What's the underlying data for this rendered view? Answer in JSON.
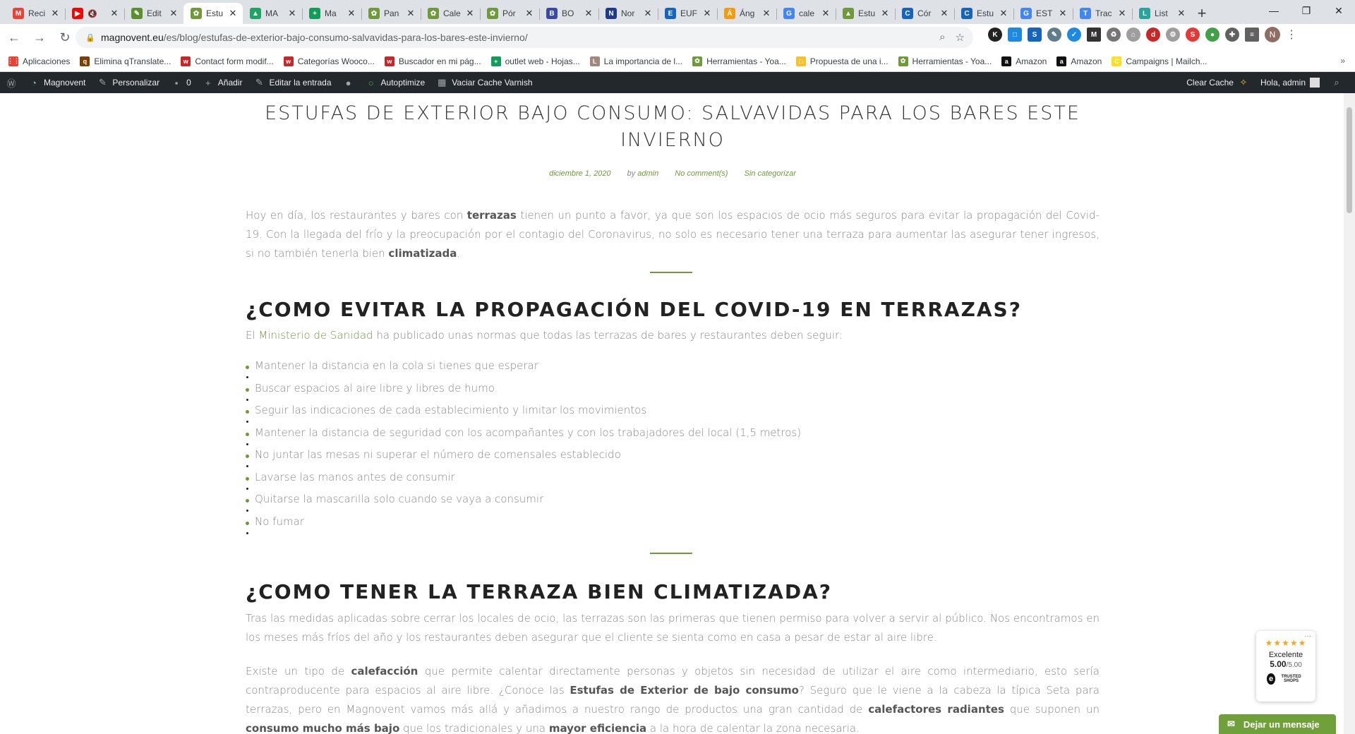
{
  "browser": {
    "tabs": [
      {
        "title": "Reci",
        "fav": "M",
        "color": "#ea4335",
        "active": false
      },
      {
        "title": "",
        "fav": "▶",
        "color": "#ff0000",
        "active": false,
        "muted": true
      },
      {
        "title": "Edit",
        "fav": "✎",
        "color": "#5a8f29",
        "active": false
      },
      {
        "title": "Estu",
        "fav": "✿",
        "color": "#6f9a3a",
        "active": true
      },
      {
        "title": "MA",
        "fav": "▲",
        "color": "#1fa463",
        "active": false
      },
      {
        "title": "Ma",
        "fav": "+",
        "color": "#0f9d58",
        "active": false
      },
      {
        "title": "Pan",
        "fav": "✿",
        "color": "#6f9a3a",
        "active": false
      },
      {
        "title": "Cale",
        "fav": "✿",
        "color": "#6f9a3a",
        "active": false
      },
      {
        "title": "Pór",
        "fav": "✿",
        "color": "#6f9a3a",
        "active": false
      },
      {
        "title": "BO",
        "fav": "B",
        "color": "#3949ab",
        "active": false
      },
      {
        "title": "Nor",
        "fav": "N",
        "color": "#1e3a8a",
        "active": false
      },
      {
        "title": "EUF",
        "fav": "E",
        "color": "#1565c0",
        "active": false
      },
      {
        "title": "Áng",
        "fav": "Á",
        "color": "#f39c12",
        "active": false
      },
      {
        "title": "cale",
        "fav": "G",
        "color": "#4285f4",
        "active": false
      },
      {
        "title": "Estu",
        "fav": "▲",
        "color": "#6f9a3a",
        "active": false
      },
      {
        "title": "Cór",
        "fav": "C",
        "color": "#1565c0",
        "active": false
      },
      {
        "title": "Estu",
        "fav": "C",
        "color": "#1565c0",
        "active": false
      },
      {
        "title": "EST",
        "fav": "G",
        "color": "#4285f4",
        "active": false
      },
      {
        "title": "Trac",
        "fav": "T",
        "color": "#4285f4",
        "active": false
      },
      {
        "title": "List",
        "fav": "L",
        "color": "#26a69a",
        "active": false
      }
    ],
    "newtab_label": "+",
    "url_host": "magnovent.eu",
    "url_path": "/es/blog/estufas-de-exterior-bajo-consumo-salvavidas-para-los-bares-este-invierno/",
    "avatar_letter": "N",
    "bookmarks": [
      {
        "label": "Aplicaciones",
        "icon": "⋮⋮",
        "color": "#ea4335"
      },
      {
        "label": "Elimina qTranslate...",
        "icon": "q",
        "color": "#7b3f00"
      },
      {
        "label": "Contact form modif...",
        "icon": "w",
        "color": "#c62828"
      },
      {
        "label": "Categorías Wooco...",
        "icon": "w",
        "color": "#c62828"
      },
      {
        "label": "Buscador en mi pág...",
        "icon": "w",
        "color": "#c62828"
      },
      {
        "label": "outlet web - Hojas...",
        "icon": "+",
        "color": "#0f9d58"
      },
      {
        "label": "La importancia de l...",
        "icon": "L",
        "color": "#a1887f"
      },
      {
        "label": "Herramientas - Yoa...",
        "icon": "✿",
        "color": "#6f9a3a"
      },
      {
        "label": "Propuesta de una i...",
        "icon": "□",
        "color": "#fbc02d"
      },
      {
        "label": "Herramientas - Yoa...",
        "icon": "✿",
        "color": "#6f9a3a"
      },
      {
        "label": "Amazon",
        "icon": "a",
        "color": "#111111"
      },
      {
        "label": "Amazon",
        "icon": "a",
        "color": "#111111"
      },
      {
        "label": "Campaigns | Mailch...",
        "icon": "C",
        "color": "#ffe01b"
      }
    ]
  },
  "wpbar": {
    "site": "Magnovent",
    "customize": "Personalizar",
    "comments": "0",
    "add": "Añadir",
    "edit": "Editar la entrada",
    "autoptimize": "Autoptimize",
    "varnish": "Vaciar Cache Varnish",
    "clear_cache": "Clear Cache",
    "greeting": "Hola, admin"
  },
  "post": {
    "title_line1": "ESTUFAS DE EXTERIOR BAJO CONSUMO: SALVAVIDAS PARA LOS BARES ESTE",
    "title_line2": "INVIERNO",
    "date": "diciembre 1, 2020",
    "by": "by",
    "author": "admin",
    "comments": "No comment(s)",
    "category": "Sin categorizar",
    "intro_a": "Hoy en día, los restaurantes y bares con ",
    "intro_b": "terrazas",
    "intro_c": " tienen un punto a favor, ya que son los espacios de ocio más seguros para evitar la propagación del Covid-19. Con la llegada del frío y la preocupación por el contagio del Coronavirus, no solo es necesario tener una terraza para aumentar las asegurar tener ingresos, si no también tenerla bien ",
    "intro_d": "climatizada",
    "intro_e": ".",
    "h2_1": "¿COMO EVITAR LA PROPAGACIÓN DEL COVID-19 EN TERRAZAS?",
    "p2_a": "El ",
    "p2_link": "Ministerio de Sanidad",
    "p2_b": " ha publicado unas normas que todas las terrazas de bares y restaurantes deben seguir:",
    "rules": [
      "Mantener la distancia en la cola si tienes que esperar",
      "Buscar espacios al aire libre y libres de humo",
      "Seguir las indicaciones de cada establecimiento y limitar los movimientos",
      "Mantener la distancia de seguridad con los acompañantes y con los trabajadores del local (1,5 metros)",
      "No juntar las mesas ni superar el número de comensales establecido",
      "Lavarse las manos antes de consumir",
      "Quitarse la mascarilla solo cuando se vaya a consumir",
      "No fumar"
    ],
    "h2_2": "¿COMO TENER LA TERRAZA BIEN CLIMATIZADA?",
    "p3": "Tras las medidas aplicadas sobre cerrar los locales de ocio, las terrazas son las primeras que tienen permiso para volver a servir al público. Nos encontramos en los meses más fríos del año y los restaurantes deben asegurar que el cliente se sienta como en casa a pesar de estar al aire libre.",
    "p4_a": "Existe un tipo de ",
    "p4_b": "calefacción",
    "p4_c": " que permite calentar directamente personas y objetos sin necesidad de utilizar el aire como intermediario, esto sería contraproducente para espacios al aire libre. ¿Conoce las ",
    "p4_d": "Estufas de Exterior de bajo consumo",
    "p4_e": "? Seguro que le viene a la cabeza la típica Seta para terrazas, pero en Magnovent vamos más allá y añadimos a nuestro rango de productos una gran cantidad de ",
    "p4_f": "calefactores radiantes",
    "p4_g": " que suponen un ",
    "p4_h": "consumo mucho más bajo",
    "p4_i": " que los tradicionales y una ",
    "p4_j": "mayor eficiencia",
    "p4_k": " a la hora de calentar la zona necesaria."
  },
  "trusted": {
    "stars": "★★★★★",
    "label": "Excelente",
    "score": "5.00",
    "max": "/5.00",
    "badge": "TRUSTED SHOPS",
    "more": "···"
  },
  "chat": {
    "label": "Dejar un mensaje"
  }
}
